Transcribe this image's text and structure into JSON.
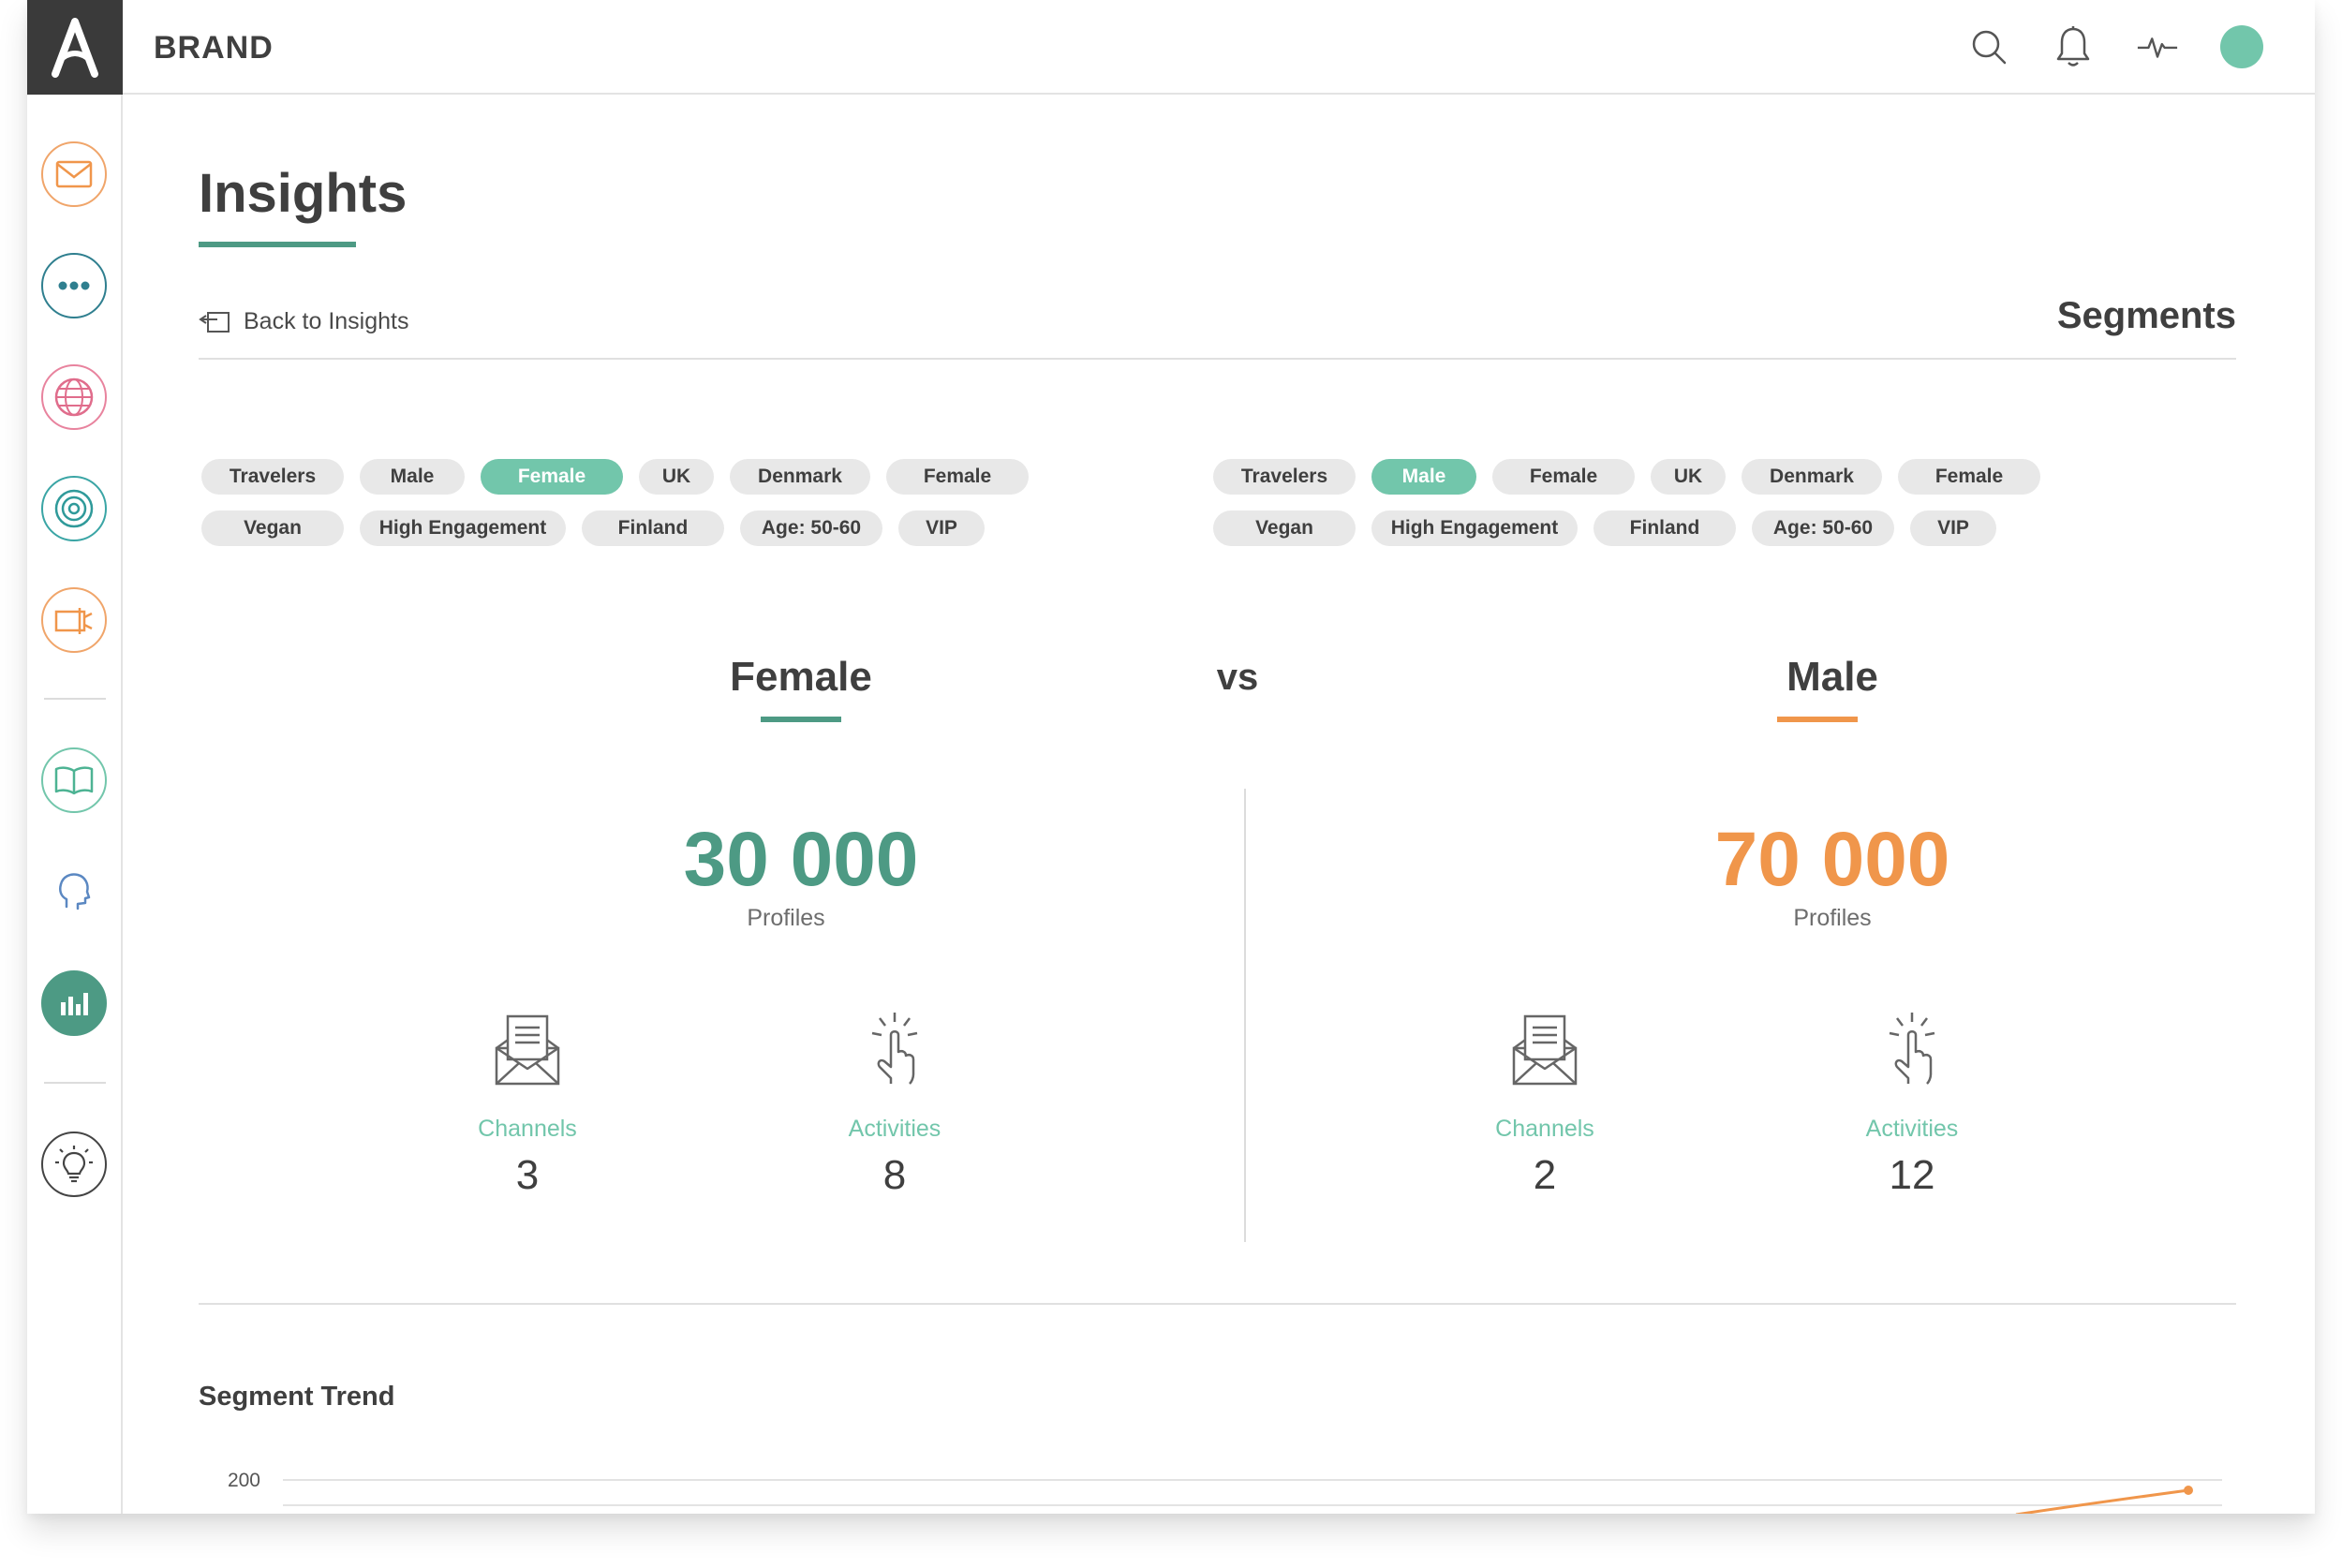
{
  "header": {
    "brand": "BRAND"
  },
  "icons": {
    "logo": "logo-icon",
    "top": [
      "search-icon",
      "bell-icon",
      "activity-icon",
      "avatar"
    ],
    "sidebar": [
      "mail-icon",
      "more-icon",
      "globe-icon",
      "target-icon",
      "campaign-icon",
      "book-icon",
      "head-icon",
      "chart-icon",
      "lightbulb-icon"
    ]
  },
  "colors": {
    "teal": "#4d9a84",
    "mint": "#72c6ab",
    "orange": "#f0964b",
    "dark": "#3a3a3a"
  },
  "page": {
    "title": "Insights",
    "back_label": "Back to Insights",
    "section": "Segments"
  },
  "left_tags": {
    "row1": [
      "Travelers",
      "Male",
      "Female",
      "UK",
      "Denmark",
      "Female"
    ],
    "row2": [
      "Vegan",
      "High Engagement",
      "Finland",
      "Age: 50-60",
      "VIP"
    ],
    "active": "Female"
  },
  "right_tags": {
    "row1": [
      "Travelers",
      "Male",
      "Female",
      "UK",
      "Denmark",
      "Female"
    ],
    "row2": [
      "Vegan",
      "High Engagement",
      "Finland",
      "Age: 50-60",
      "VIP"
    ],
    "active": "Male"
  },
  "comparison": {
    "vs": "vs",
    "left": {
      "name": "Female",
      "profiles": "30 000",
      "profiles_label": "Profiles",
      "channels_label": "Channels",
      "channels": "3",
      "activities_label": "Activities",
      "activities": "8"
    },
    "right": {
      "name": "Male",
      "profiles": "70 000",
      "profiles_label": "Profiles",
      "channels_label": "Channels",
      "channels": "2",
      "activities_label": "Activities",
      "activities": "12"
    }
  },
  "trend": {
    "title": "Segment Trend",
    "y_tick": "200"
  }
}
